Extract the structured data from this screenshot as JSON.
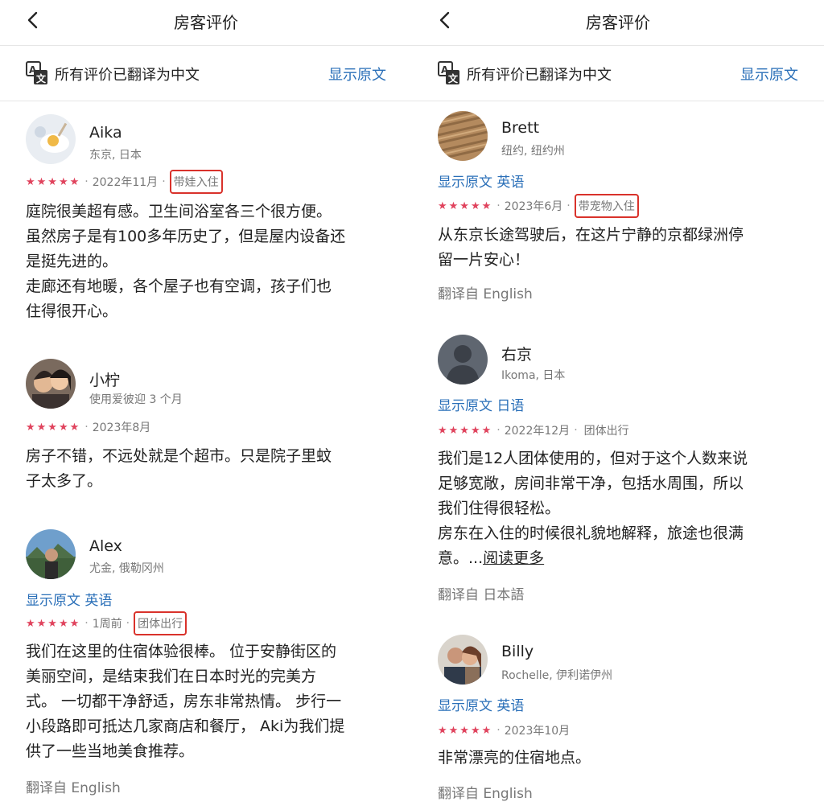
{
  "left": {
    "title": "房客评价",
    "translate_notice": "所有评价已翻译为中文",
    "show_original": "显示原文",
    "reviews": [
      {
        "name": "Aika",
        "location": "东京, 日本",
        "stars": "★★★★★",
        "date": "2022年11月",
        "tag": "带娃入住",
        "text": [
          "庭院很美超有感。卫生间浴室各三个很方便。",
          "虽然房子是有100多年历史了，但是屋内设备还",
          "是挺先进的。",
          "走廊还有地暖，各个屋子也有空调，孩子们也",
          "住得很开心。"
        ]
      },
      {
        "name": "小柠",
        "location": "使用爱彼迎 3 个月",
        "stars": "★★★★★",
        "date": "2023年8月",
        "text": [
          "房子不错，不远处就是个超市。只是院子里蚊",
          "子太多了。"
        ]
      },
      {
        "name": "Alex",
        "location": "尤金, 俄勒冈州",
        "show_original": "显示原文 英语",
        "stars": "★★★★★",
        "date": "1周前",
        "tag": "团体出行",
        "text": [
          "我们在这里的住宿体验很棒。 位于安静街区的",
          "美丽空间，是结束我们在日本时光的完美方",
          "式。 一切都干净舒适，房东非常热情。 步行一",
          "小段路即可抵达几家商店和餐厅， Aki为我们提",
          "供了一些当地美食推荐。"
        ],
        "translated_from": "翻译自 English"
      }
    ]
  },
  "right": {
    "title": "房客评价",
    "translate_notice": "所有评价已翻译为中文",
    "show_original": "显示原文",
    "reviews": [
      {
        "name": "Brett",
        "location": "纽约, 纽约州",
        "show_original": "显示原文 英语",
        "stars": "★★★★★",
        "date": "2023年6月",
        "tag": "带宠物入住",
        "text": [
          "从东京长途驾驶后，在这片宁静的京都绿洲停",
          "留一片安心！"
        ],
        "translated_from": "翻译自 English"
      },
      {
        "name": "右京",
        "location": "Ikoma, 日本",
        "show_original": "显示原文 日语",
        "stars": "★★★★★",
        "date": "2022年12月",
        "tag": "团体出行",
        "text": [
          "我们是12人团体使用的，但对于这个人数来说",
          "足够宽敞，房间非常干净，包括水周围，所以",
          "我们住得很轻松。",
          "房东在入住的时候很礼貌地解释，旅途也很满"
        ],
        "text_last_prefix": "意。...",
        "read_more": "阅读更多",
        "translated_from": "翻译自 日本語"
      },
      {
        "name": "Billy",
        "location": "Rochelle, 伊利诺伊州",
        "show_original": "显示原文 英语",
        "stars": "★★★★★",
        "date": "2023年10月",
        "text": [
          "非常漂亮的住宿地点。"
        ],
        "translated_from": "翻译自 English"
      }
    ]
  },
  "colors": {
    "link": "#2a6fb8",
    "star": "#e0435d",
    "highlight_box": "#d9322b",
    "muted": "#777777"
  }
}
